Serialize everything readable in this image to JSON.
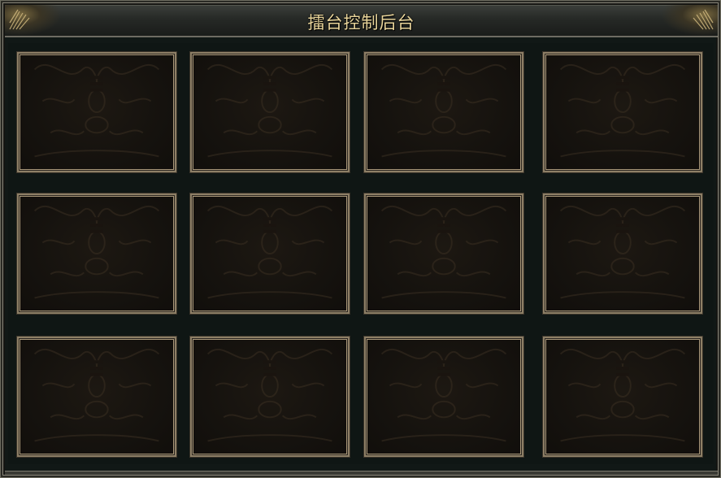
{
  "window": {
    "title": "擂台控制后台"
  },
  "slots": [
    {
      "id": 1
    },
    {
      "id": 2
    },
    {
      "id": 3
    },
    {
      "id": 4
    },
    {
      "id": 5
    },
    {
      "id": 6
    },
    {
      "id": 7
    },
    {
      "id": 8
    },
    {
      "id": 9
    },
    {
      "id": 10
    },
    {
      "id": 11
    },
    {
      "id": 12
    }
  ],
  "colors": {
    "title_text": "#e8d49a",
    "panel_bg": "#111816",
    "slot_border": "#8d7f66",
    "slot_bg": "#15120e"
  },
  "icons": {
    "corner_left": "ornament-corner-icon",
    "corner_right": "ornament-corner-icon",
    "slot_background": "ornate-pattern-icon"
  }
}
